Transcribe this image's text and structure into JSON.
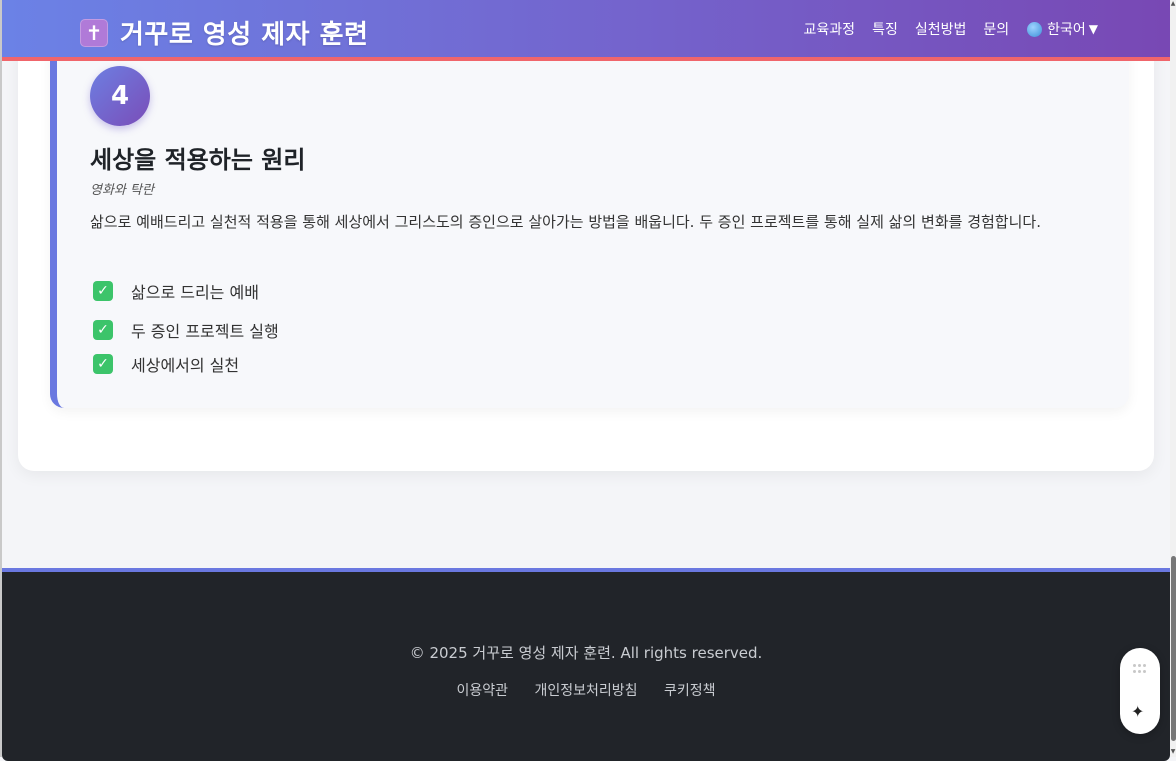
{
  "header": {
    "logo_icon": "✝",
    "title": "거꾸로 영성 제자 훈련",
    "nav": [
      "교육과정",
      "특징",
      "실천방법",
      "문의"
    ],
    "language": "한국어",
    "colors": {
      "gradient_start": "#6b82e6",
      "gradient_end": "#7848b4",
      "accent_line": "#f0656b"
    }
  },
  "step": {
    "number": "4",
    "title": "세상을 적용하는 원리",
    "subtitle": "영화와 탁란",
    "description": "삶으로 예배드리고 실천적 적용을 통해 세상에서 그리스도의 증인으로 살아가는 방법을 배웁니다. 두 증인 프로젝트를 통해 실제 삶의 변화를 경험합니다.",
    "checklist": [
      "삶으로 드리는 예배",
      "두 증인 프로젝트 실행",
      "세상에서의 실천"
    ],
    "check_icon": "✓"
  },
  "footer": {
    "copyright": "© 2025 거꾸로 영성 제자 훈련. All rights reserved.",
    "links": [
      "이용약관",
      "개인정보처리방침",
      "쿠키정책"
    ]
  },
  "widget": {
    "sparkle_icon": "✦"
  }
}
